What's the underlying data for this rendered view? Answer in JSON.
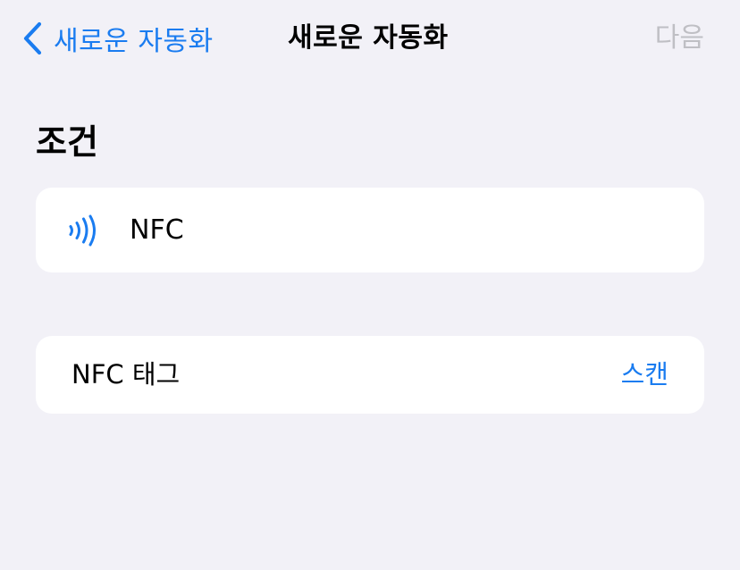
{
  "nav": {
    "back_label": "새로운 자동화",
    "title": "새로운 자동화",
    "next_label": "다음"
  },
  "section": {
    "header": "조건"
  },
  "trigger_card": {
    "icon": "nfc-waves-icon",
    "label": "NFC"
  },
  "tag_card": {
    "label": "NFC 태그",
    "action_label": "스캔"
  },
  "colors": {
    "accent": "#1a7cf0",
    "background": "#f2f1f7",
    "card": "#ffffff",
    "disabled": "#bfbfc4"
  }
}
